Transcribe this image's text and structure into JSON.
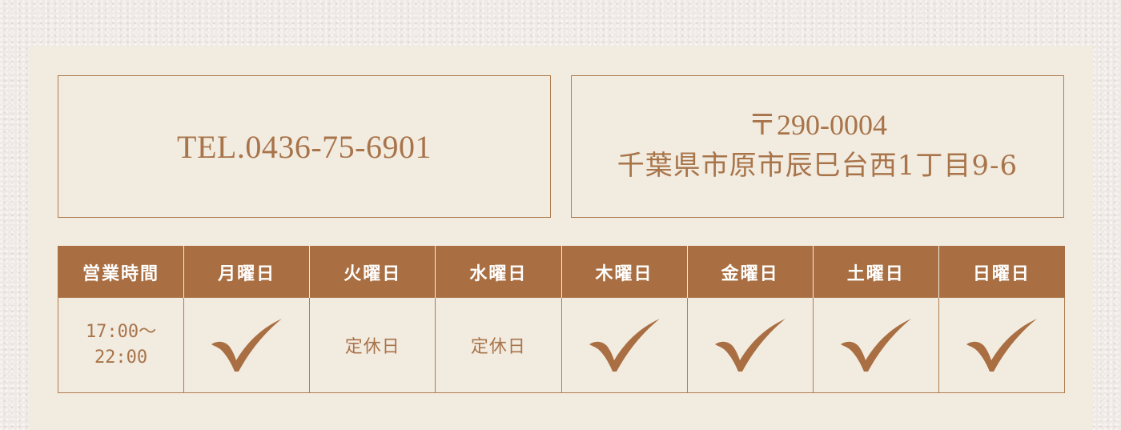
{
  "contact": {
    "tel": "TEL.0436-75-6901",
    "postal": "〒290-0004",
    "address": "千葉県市原市辰巳台西1丁目9-6"
  },
  "hours": {
    "header_label": "営業時間",
    "days": [
      "月曜日",
      "火曜日",
      "水曜日",
      "木曜日",
      "金曜日",
      "土曜日",
      "日曜日"
    ],
    "time_line1": "17:00〜",
    "time_line2": "22:00",
    "closed_label": "定休日",
    "status": [
      "open",
      "closed",
      "closed",
      "open",
      "open",
      "open",
      "open"
    ]
  },
  "colors": {
    "accent": "#a96f42",
    "text": "#a8744a",
    "panel": "#f2ebe0"
  },
  "icons": {
    "open_marker": "check-mark-icon"
  }
}
